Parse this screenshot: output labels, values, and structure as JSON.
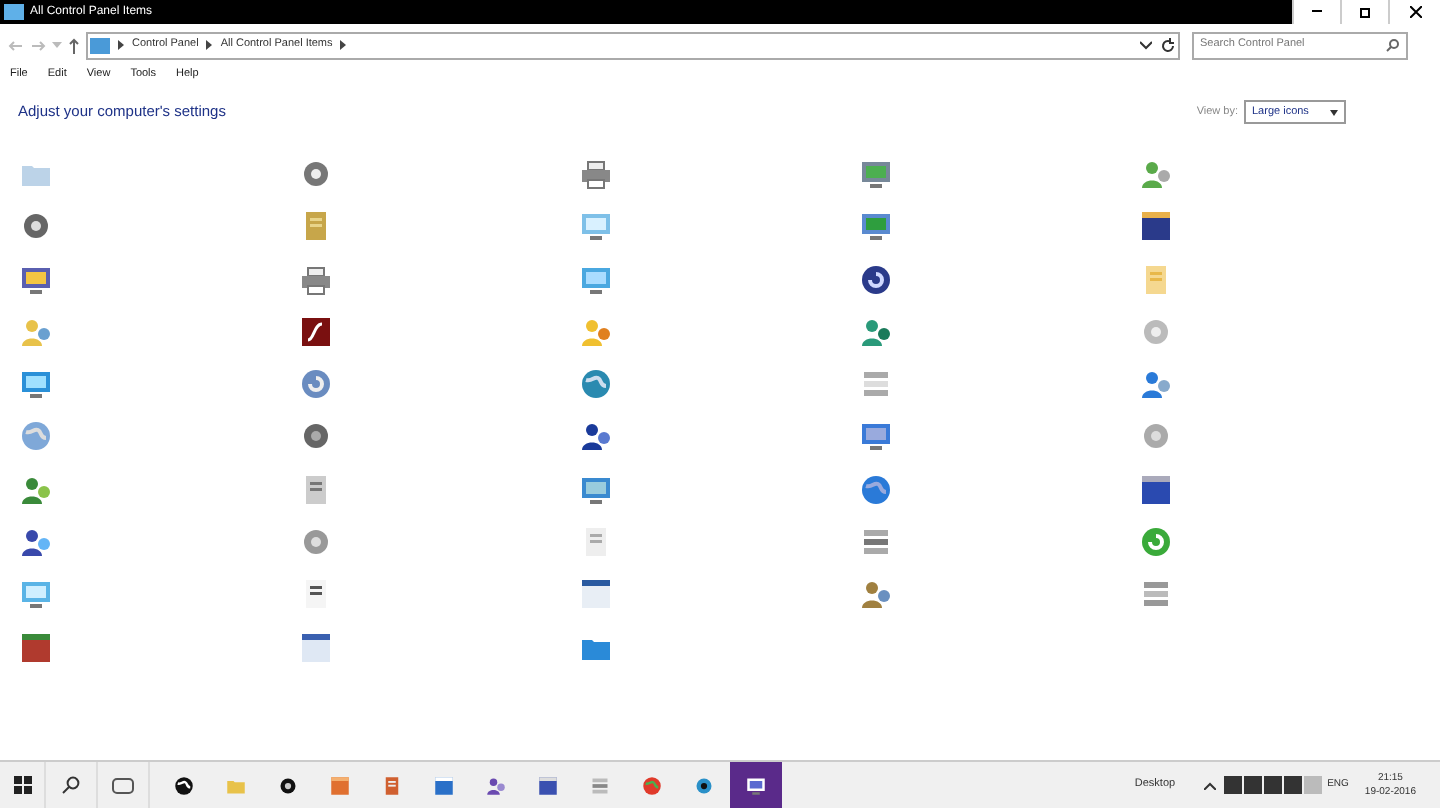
{
  "window": {
    "title": "All Control Panel Items"
  },
  "address": {
    "path": [
      "Control Panel",
      "All Control Panel Items"
    ]
  },
  "search": {
    "placeholder": "Search Control Panel"
  },
  "menu": [
    "File",
    "Edit",
    "View",
    "Tools",
    "Help"
  ],
  "heading": "Adjust your computer's settings",
  "view_by": {
    "label": "View by:",
    "value": "Large icons"
  },
  "taskbar": {
    "apps": [
      {
        "selected": false
      },
      {
        "selected": false
      },
      {
        "selected": false
      },
      {
        "selected": false
      },
      {
        "selected": false
      },
      {
        "selected": false
      },
      {
        "selected": false
      },
      {
        "selected": false
      },
      {
        "selected": false
      },
      {
        "selected": false
      },
      {
        "selected": false
      },
      {
        "selected": true
      }
    ],
    "desktop_label": "Desktop",
    "language": "ENG",
    "time": "21:15",
    "date": "19-02-2016"
  }
}
